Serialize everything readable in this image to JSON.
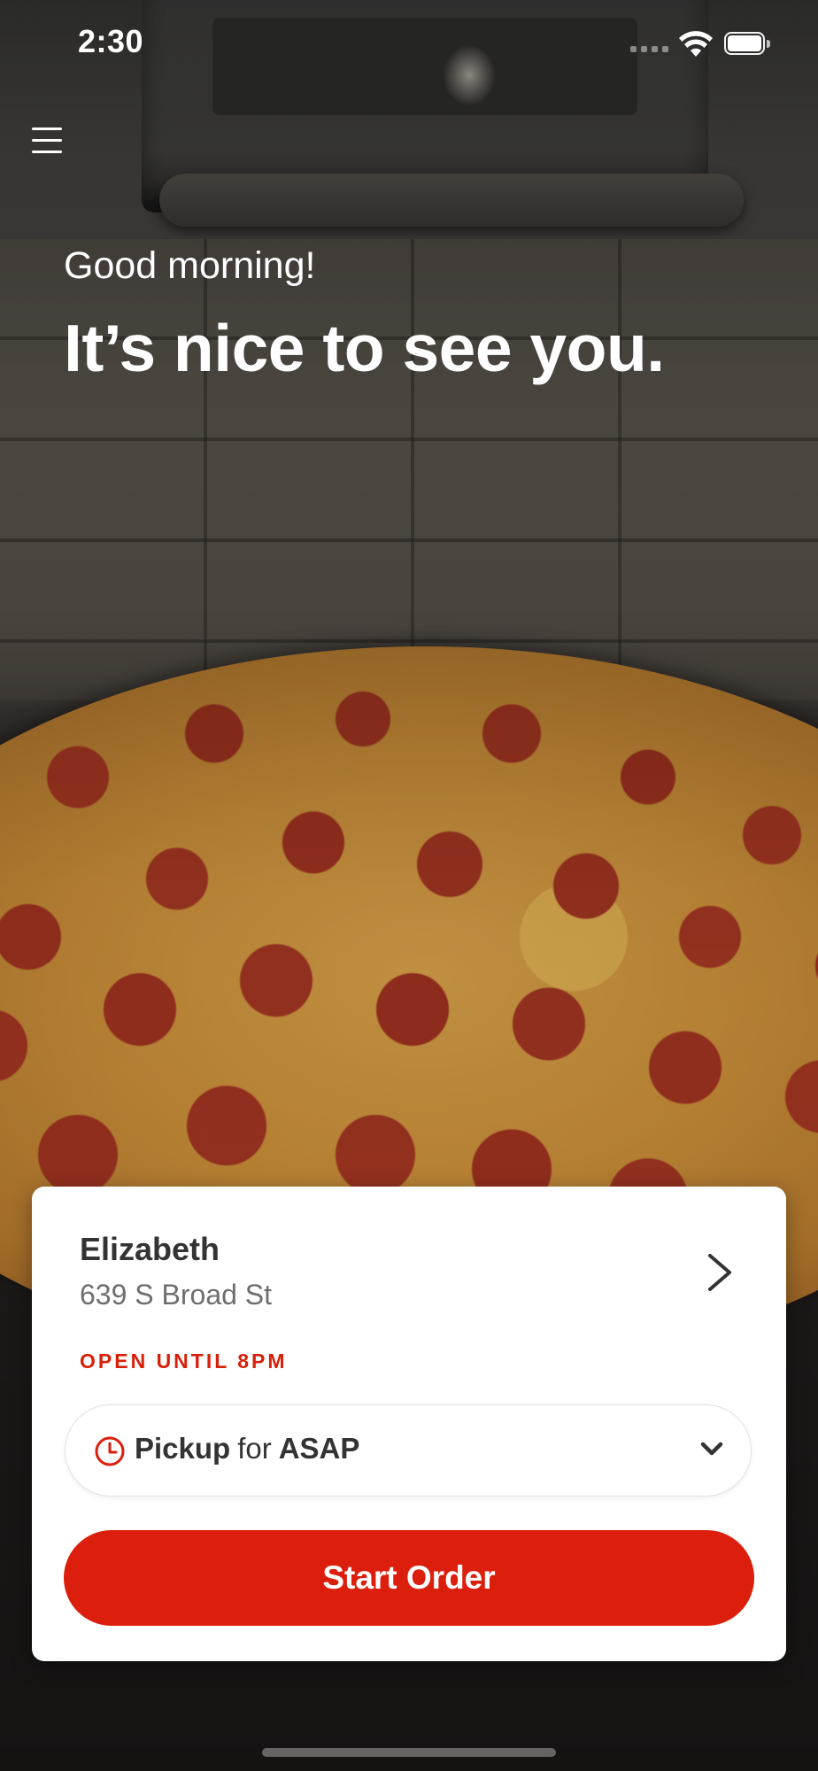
{
  "status_bar": {
    "time": "2:30"
  },
  "menu": {
    "icon": "hamburger-menu-icon"
  },
  "greeting": {
    "salutation": "Good morning!",
    "headline": "It’s nice to see you."
  },
  "store": {
    "name": "Elizabeth",
    "address": "639 S Broad St",
    "hours_status": "OPEN UNTIL 8PM"
  },
  "order_mode": {
    "method": "Pickup",
    "connector": "for",
    "time": "ASAP",
    "icon": "clock-icon"
  },
  "cta": {
    "label": "Start Order"
  },
  "colors": {
    "accent": "#dc1f0c",
    "card_background": "#ffffff",
    "text_primary": "#333333",
    "text_secondary": "#6e6e6e"
  }
}
